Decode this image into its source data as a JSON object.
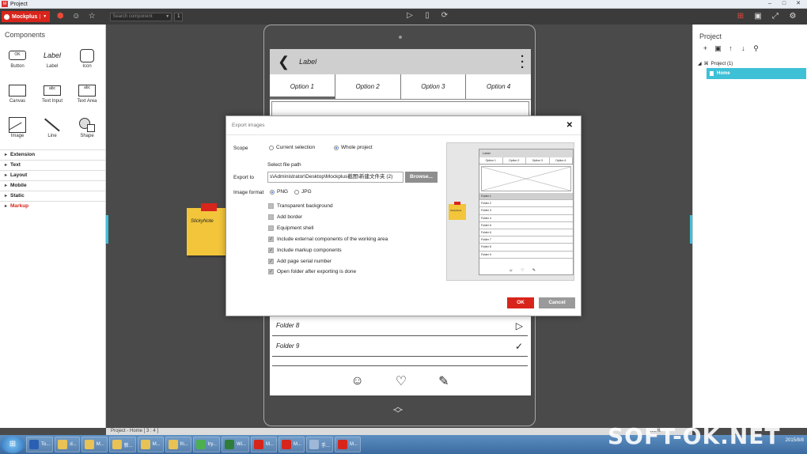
{
  "window": {
    "title": "Project",
    "controls": [
      "–",
      "□",
      "✕"
    ]
  },
  "toolbar": {
    "brand": "Mockplus",
    "search_placeholder": "Search component",
    "search_count": "1"
  },
  "left_panel": {
    "title": "Components",
    "components": [
      {
        "label": "Button",
        "icon": "button-icon",
        "glyph": "OK"
      },
      {
        "label": "Label",
        "icon": "label-icon",
        "glyph": "Label"
      },
      {
        "label": "Icon",
        "icon": "icon-box-icon",
        "glyph": ""
      },
      {
        "label": "Canvas",
        "icon": "canvas-icon",
        "glyph": ""
      },
      {
        "label": "Text Input",
        "icon": "text-input-icon",
        "glyph": "abc"
      },
      {
        "label": "Text Area",
        "icon": "text-area-icon",
        "glyph": "abc"
      },
      {
        "label": "Image",
        "icon": "image-icon",
        "glyph": ""
      },
      {
        "label": "Line",
        "icon": "line-icon",
        "glyph": ""
      },
      {
        "label": "Shape",
        "icon": "shape-icon",
        "glyph": ""
      }
    ],
    "categories": [
      "Extension",
      "Text",
      "Layout",
      "Mobile",
      "Static",
      "Markup"
    ]
  },
  "right_panel": {
    "title": "Project",
    "tree_root": "Project (1)",
    "tree_home": "Home"
  },
  "device": {
    "header_label": "Label",
    "tabs": [
      "Option 1",
      "Option 2",
      "Option 3",
      "Option 4"
    ],
    "folders": [
      {
        "label": "Folder 8",
        "action": "▷"
      },
      {
        "label": "Folder 9",
        "action": "✓"
      }
    ]
  },
  "sticky": {
    "text": "StickyNote"
  },
  "dialog": {
    "title": "Export images",
    "scope_label": "Scope",
    "scope_options": [
      "Current selection",
      "Whole project"
    ],
    "select_path_label": "Select file path",
    "export_to_label": "Export to",
    "path_value": "s\\Administrator\\Desktop\\Mockplus截图\\新建文件夹 (2)",
    "browse": "Browse...",
    "format_label": "Image format",
    "format_options": [
      "PNG",
      "JPG"
    ],
    "checks": [
      {
        "label": "Transparent background",
        "checked": false
      },
      {
        "label": "Add border",
        "checked": false
      },
      {
        "label": "Equipment shell",
        "checked": false
      },
      {
        "label": "Include external components of the working area",
        "checked": true
      },
      {
        "label": "Include markup components",
        "checked": true
      },
      {
        "label": "Add page serial number",
        "checked": true
      },
      {
        "label": "Open folder after exporting is done",
        "checked": true
      }
    ],
    "ok": "OK",
    "cancel": "Cancel",
    "preview": {
      "header": "Label",
      "tabs": [
        "Option 1",
        "Option 2",
        "Option 3",
        "Option 4"
      ],
      "rows": [
        "Folder 1",
        "Folder 2",
        "Folder 3",
        "Folder 4",
        "Folder 5",
        "Folder 6",
        "Folder 7",
        "Folder 8",
        "Folder 9"
      ],
      "sticky": "StickyNote"
    }
  },
  "status": {
    "text": "Project - Home [ 3 : 4 ]",
    "zoom": "100%"
  },
  "taskbar": {
    "items": [
      "To...",
      "d...",
      "M...",
      "新...",
      "M...",
      "fri...",
      "try...",
      "Wi...",
      "M...",
      "M...",
      "手...",
      "M...",
      "Li...",
      "M..."
    ],
    "date": "2015/8/8"
  },
  "watermark": "SOFT-OK.NET",
  "colors": {
    "accent": "#d8251c",
    "selection": "#3ec0d6",
    "sticky": "#f2c53b"
  }
}
